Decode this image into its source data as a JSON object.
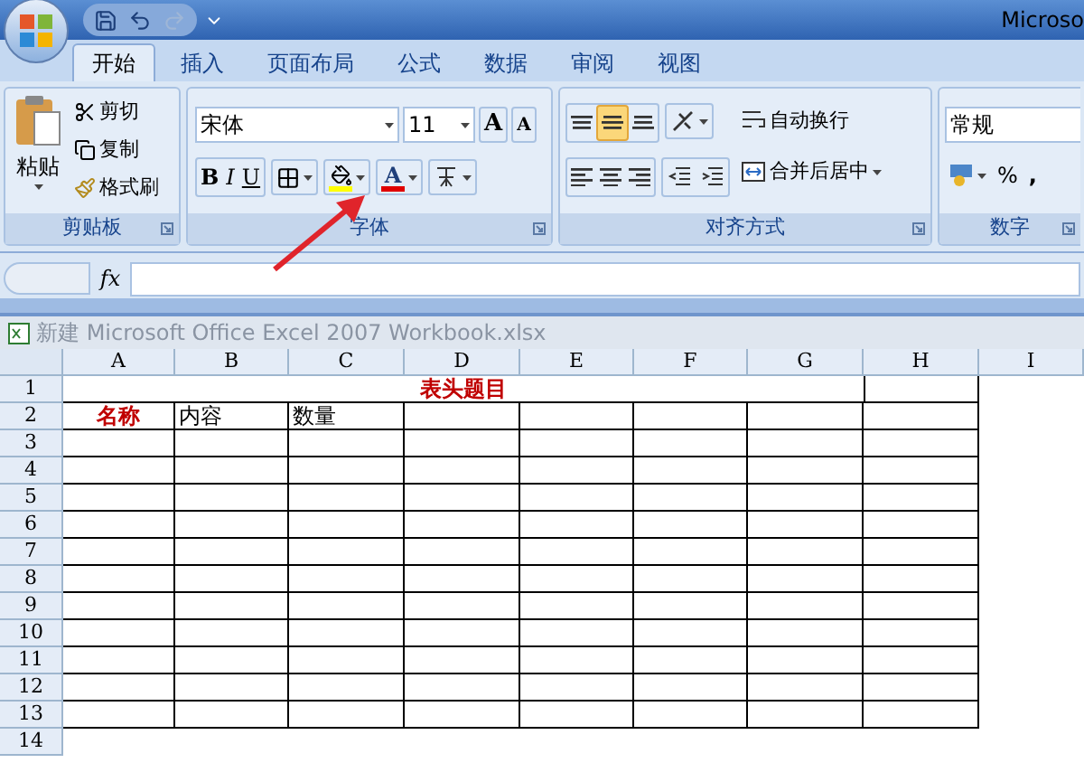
{
  "title_bar": {
    "title": "Microso"
  },
  "tabs": [
    {
      "label": "开始",
      "selected": true
    },
    {
      "label": "插入",
      "selected": false
    },
    {
      "label": "页面布局",
      "selected": false
    },
    {
      "label": "公式",
      "selected": false
    },
    {
      "label": "数据",
      "selected": false
    },
    {
      "label": "审阅",
      "selected": false
    },
    {
      "label": "视图",
      "selected": false
    }
  ],
  "clipboard": {
    "paste": "粘贴",
    "cut": "剪切",
    "copy": "复制",
    "format_painter": "格式刷",
    "label": "剪贴板"
  },
  "font": {
    "name": "宋体",
    "size": "11",
    "grow": "A",
    "shrink": "A",
    "bold": "B",
    "italic": "I",
    "underline": "U",
    "font_color": "A",
    "label": "字体"
  },
  "alignment": {
    "vertical": [
      {
        "selected": false
      },
      {
        "selected": true
      },
      {
        "selected": false
      }
    ],
    "wrap": "自动换行",
    "merge": "合并后居中",
    "label": "对齐方式"
  },
  "number": {
    "format": "常规",
    "percent": "%",
    "comma": ",",
    "label": "数字"
  },
  "formula_bar": {
    "fx": "fx"
  },
  "workbook": {
    "title": "新建 Microsoft Office Excel 2007 Workbook.xlsx"
  },
  "columns": [
    "A",
    "B",
    "C",
    "D",
    "E",
    "F",
    "G",
    "H",
    "I"
  ],
  "rows": [
    {
      "number": "1",
      "kind": "title",
      "text": "表头题目"
    },
    {
      "number": "2",
      "kind": "normal",
      "cells": [
        {
          "text": "名称",
          "kind": "heading"
        },
        {
          "text": "内容",
          "kind": "plain"
        },
        {
          "text": "数量",
          "kind": "plain"
        }
      ]
    },
    {
      "number": "3",
      "kind": "normal"
    },
    {
      "number": "4",
      "kind": "normal"
    },
    {
      "number": "5",
      "kind": "normal"
    },
    {
      "number": "6",
      "kind": "normal"
    },
    {
      "number": "7",
      "kind": "normal"
    },
    {
      "number": "8",
      "kind": "normal"
    },
    {
      "number": "9",
      "kind": "normal"
    },
    {
      "number": "10",
      "kind": "normal"
    },
    {
      "number": "11",
      "kind": "normal"
    },
    {
      "number": "12",
      "kind": "normal"
    },
    {
      "number": "13",
      "kind": "normal"
    },
    {
      "number": "14",
      "kind": "normal"
    }
  ]
}
